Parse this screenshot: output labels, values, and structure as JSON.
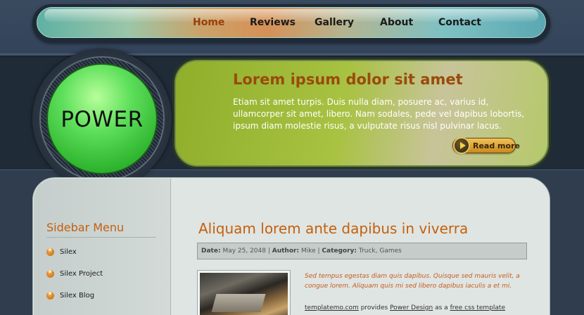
{
  "nav": {
    "items": [
      {
        "label": "Home",
        "active": true
      },
      {
        "label": "Reviews"
      },
      {
        "label": "Gallery"
      },
      {
        "label": "About"
      },
      {
        "label": "Contact"
      }
    ]
  },
  "logo": {
    "text": "POWER"
  },
  "banner": {
    "title": "Lorem ipsum dolor sit amet",
    "text": "Etiam sit amet turpis. Duis nulla diam, posuere ac, varius id, ullamcorper sit amet, libero. Nam sodales, pede vel dapibus lobortis, ipsum diam molestie risus, a vulputate risus nisl pulvinar lacus.",
    "read_more": "Read more"
  },
  "sidebar": {
    "title": "Sidebar Menu",
    "items": [
      {
        "label": "Silex"
      },
      {
        "label": "Silex Project"
      },
      {
        "label": "Silex Blog"
      }
    ]
  },
  "post": {
    "title": "Aliquam lorem ante dapibus in viverra",
    "meta": {
      "date_label": "Date:",
      "date": "May 25, 2048",
      "author_label": "Author:",
      "author": "Mike",
      "category_label": "Category:",
      "category": "Truck, Games"
    },
    "intro": "Sed tempus egestas diam quis dapibus. Quisque sed mauris velit, a congue lorem. Aliquam quis mi sed libero dapibus iaculis a et mi.",
    "credit": {
      "site": "templatemo.com",
      "provides": "provides",
      "design": "Power Design",
      "as_a": "as a",
      "template": "free css template"
    }
  },
  "colors": {
    "accent": "#c4600e",
    "power_green": "#5fe05c",
    "page_bg": "#2f3d4f"
  }
}
